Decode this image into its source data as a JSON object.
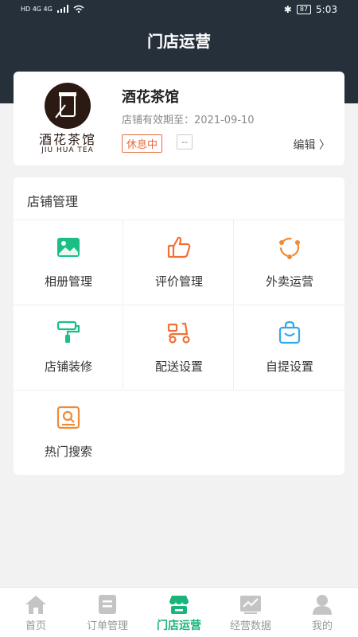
{
  "status_bar": {
    "network_left": "HD 4G 4G",
    "time": "5:03",
    "battery": "87"
  },
  "header": {
    "title": "门店运营"
  },
  "store": {
    "logo_cn": "酒花茶馆",
    "logo_en": "JIU HUA TEA",
    "name": "酒花茶馆",
    "valid_until": "店铺有效期至：2021-09-10",
    "status_badge": "休息中",
    "extra_badge": "--",
    "edit_label": "编辑"
  },
  "management": {
    "title": "店铺管理",
    "items": [
      {
        "label": "相册管理",
        "icon": "photo-album-icon",
        "color": "#1bbf85"
      },
      {
        "label": "评价管理",
        "icon": "thumbs-up-icon",
        "color": "#f07035"
      },
      {
        "label": "外卖运营",
        "icon": "share-circle-icon",
        "color": "#f08a35"
      },
      {
        "label": "店铺装修",
        "icon": "paint-roller-icon",
        "color": "#1bbf85"
      },
      {
        "label": "配送设置",
        "icon": "scooter-icon",
        "color": "#f07035"
      },
      {
        "label": "自提设置",
        "icon": "shopping-bag-icon",
        "color": "#35a8e8"
      },
      {
        "label": "热门搜索",
        "icon": "search-box-icon",
        "color": "#f08a35"
      }
    ]
  },
  "tabbar": {
    "tabs": [
      {
        "label": "首页",
        "icon": "home-icon"
      },
      {
        "label": "订单管理",
        "icon": "order-list-icon"
      },
      {
        "label": "门店运营",
        "icon": "store-icon",
        "active": true
      },
      {
        "label": "经营数据",
        "icon": "data-chart-icon"
      },
      {
        "label": "我的",
        "icon": "user-icon"
      }
    ]
  }
}
